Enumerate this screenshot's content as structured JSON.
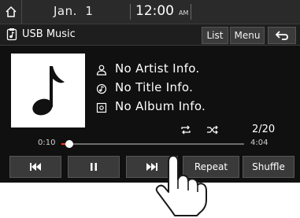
{
  "status_bar": {
    "date": "Jan.  1",
    "time": "12:00",
    "ampm": "AM",
    "home_icon": "home-icon"
  },
  "title_bar": {
    "title": "USB Music",
    "icon": "usb-music-icon",
    "list_label": "List",
    "menu_label": "Menu",
    "back_icon": "back-arrow-icon"
  },
  "track": {
    "artist": "No Artist Info.",
    "title": "No Title Info.",
    "album": "No Album Info.",
    "counter": "2/20",
    "elapsed": "0:10",
    "total": "4:04",
    "progress_fraction": 0.041
  },
  "controls": {
    "prev_icon": "previous-track-icon",
    "pause_icon": "pause-icon",
    "next_icon": "next-track-icon",
    "repeat_label": "Repeat",
    "shuffle_label": "Shuffle"
  },
  "colors": {
    "progress_accent": "#ff3a1a",
    "screen_bg": "#101010"
  }
}
